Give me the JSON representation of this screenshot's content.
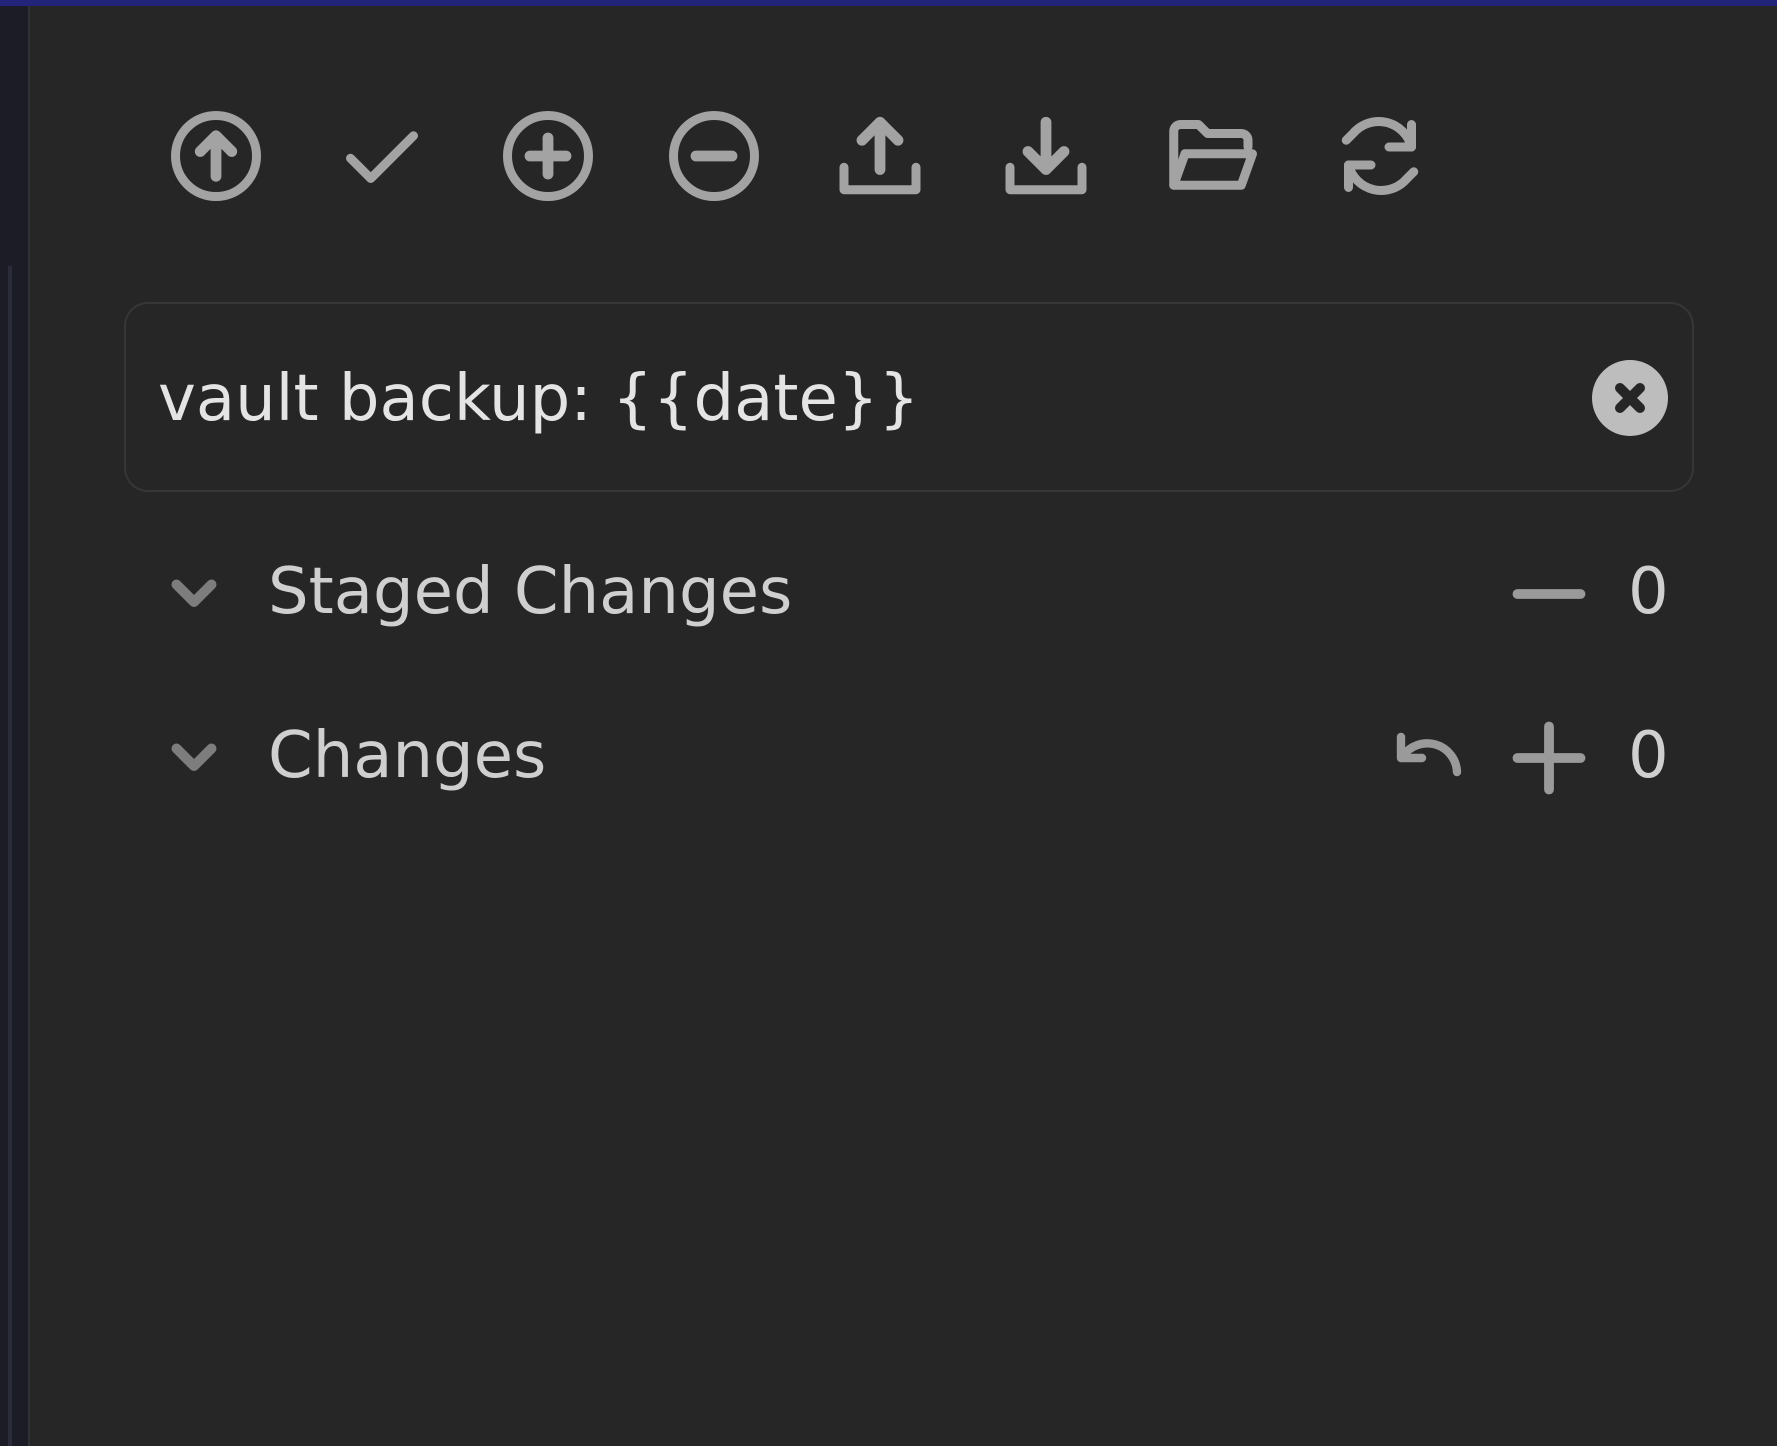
{
  "toolbar": {
    "buttons": [
      {
        "name": "push-button",
        "icon": "arrow-up-circle-icon"
      },
      {
        "name": "commit-button",
        "icon": "check-icon"
      },
      {
        "name": "stage-all-button",
        "icon": "plus-circle-icon"
      },
      {
        "name": "unstage-all-button",
        "icon": "minus-circle-icon"
      },
      {
        "name": "upload-button",
        "icon": "upload-icon"
      },
      {
        "name": "download-button",
        "icon": "download-icon"
      },
      {
        "name": "open-folder-button",
        "icon": "folder-open-icon"
      },
      {
        "name": "refresh-button",
        "icon": "refresh-icon"
      }
    ]
  },
  "commit": {
    "message": "vault backup: {{date}}"
  },
  "sections": {
    "staged": {
      "title": "Staged Changes",
      "count": "0"
    },
    "changes": {
      "title": "Changes",
      "count": "0"
    }
  },
  "colors": {
    "panel_bg": "#262626",
    "icon": "#a3a3a3",
    "text": "#cfcfcf",
    "accent_strip": "#22247a"
  }
}
